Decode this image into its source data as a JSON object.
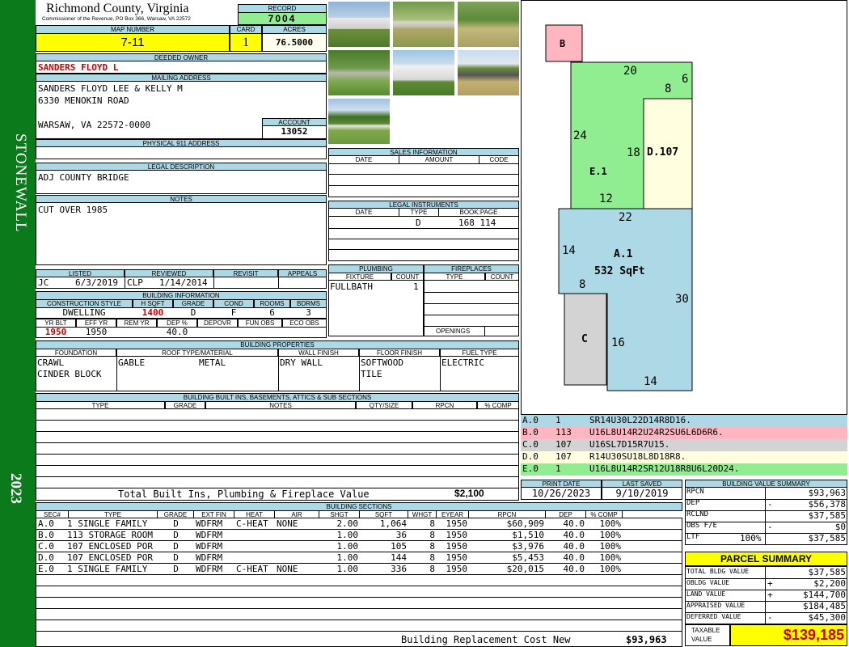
{
  "side": {
    "district": "STONEWALL",
    "year": "2023"
  },
  "header": {
    "county": "Richmond County, Virginia",
    "commissioner": "Commissioner of the Revenue, PO Box 366, Warsaw, VA 22572",
    "record_label": "RECORD",
    "record": "7004"
  },
  "ids": {
    "map_label": "MAP NUMBER",
    "map": "7-11",
    "card_label": "CARD",
    "card": "1",
    "acres_label": "ACRES",
    "acres": "76.5000"
  },
  "owner": {
    "label": "DEEDED OWNER",
    "name": "SANDERS FLOYD L",
    "mail_label": "MAILING ADDRESS",
    "mail": [
      "SANDERS FLOYD LEE & KELLY M",
      "6330 MENOKIN ROAD",
      "",
      "WARSAW, VA 22572-0000"
    ],
    "account_label": "ACCOUNT",
    "account": "13052",
    "phys_label": "PHYSICAL 911 ADDRESS",
    "phys": ""
  },
  "legal": {
    "label": "LEGAL DESCRIPTION",
    "text": "ADJ COUNTY BRIDGE"
  },
  "notes": {
    "label": "NOTES",
    "text": "CUT OVER 1985"
  },
  "sales": {
    "label": "SALES INFORMATION",
    "cols": [
      "DATE",
      "AMOUNT",
      "CODE"
    ]
  },
  "instruments": {
    "label": "LEGAL INSTRUMENTS",
    "cols": [
      "DATE",
      "TYPE",
      "BOOK:PAGE"
    ],
    "type": "D",
    "book": "168 114"
  },
  "listing": {
    "listed_label": "LISTED",
    "reviewed_label": "REVIEWED",
    "revisit_label": "REVISIT",
    "appeals_label": "APPEALS",
    "lister": "JC",
    "listed": "6/3/2019",
    "reviewer": "CLP",
    "reviewed": "1/14/2014"
  },
  "plumbing": {
    "label": "PLUMBING",
    "fixture_label": "FIXTURE",
    "count_label": "COUNT",
    "fixture": "FULLBATH",
    "count": "1"
  },
  "fireplaces": {
    "label": "FIREPLACES",
    "type_label": "TYPE",
    "count_label": "COUNT",
    "openings_label": "OPENINGS"
  },
  "building": {
    "label": "BUILDING INFORMATION",
    "cols": [
      "CONSTRUCTION STYLE",
      "H SQFT",
      "GRADE",
      "COND",
      "ROOMS",
      "BDRMS"
    ],
    "style": "DWELLING",
    "hsqft": "1400",
    "grade": "D",
    "cond": "F",
    "rooms": "6",
    "bdrms": "3",
    "cols2": [
      "YR BLT",
      "EFF YR",
      "REM YR",
      "DEP %",
      "DEPOVR",
      "FUN OBS",
      "ECO OBS"
    ],
    "yrblt": "1950",
    "effyr": "1950",
    "dep": "40.0"
  },
  "props": {
    "label": "BUILDING PROPERTIES",
    "cols": [
      "FOUNDATION",
      "ROOF TYPE/MATERIAL",
      "WALL FINISH",
      "FLOOR FINISH",
      "FUEL TYPE"
    ],
    "foundation": [
      "CRAWL",
      "CINDER BLOCK"
    ],
    "roof_type": "GABLE",
    "roof_mat": "METAL",
    "wall": "DRY WALL",
    "floor": [
      "SOFTWOOD",
      "TILE"
    ],
    "fuel": "ELECTRIC"
  },
  "builtins": {
    "label": "BUILDING BUILT INS, BASEMENTS, ATTICS & SUB SECTIONS",
    "cols": [
      "TYPE",
      "GRADE",
      "NOTES",
      "QTY/SIZE",
      "RPCN",
      "% COMP"
    ],
    "total_label": "Total Built Ins, Plumbing & Fireplace Value",
    "total": "$2,100"
  },
  "dates": {
    "print_label": "PRINT DATE",
    "print": "10/26/2023",
    "saved_label": "LAST SAVED",
    "saved": "9/10/2019"
  },
  "sketch_codes": [
    {
      "sec": "A.0",
      "code": "1",
      "path": "SR14U30L22D14R8D16.",
      "color": "#add8e6"
    },
    {
      "sec": "B.0",
      "code": "113",
      "path": "U16L8U14R2U24R2SU6L6D6R6.",
      "color": "#ffb6c1"
    },
    {
      "sec": "C.0",
      "code": "107",
      "path": "U16SL7D15R7U15.",
      "color": "#d3d3d3"
    },
    {
      "sec": "D.0",
      "code": "107",
      "path": "R14U30SU18L8D18R8.",
      "color": "#ffffe0"
    },
    {
      "sec": "E.0",
      "code": "1",
      "path": "U16L8U14R2SR12U18R8U6L20D24.",
      "color": "#90ee90"
    }
  ],
  "sketch": {
    "labels": {
      "b": "B",
      "e": "E.1",
      "d": "D.107",
      "a": "A.1",
      "a_area": "532 SqFt",
      "c": "C"
    },
    "dims": [
      "20",
      "8",
      "6",
      "24",
      "18",
      "12",
      "22",
      "14",
      "8",
      "30",
      "16",
      "14"
    ]
  },
  "sections": {
    "label": "BUILDING SECTIONS",
    "cols": [
      "SEC#",
      "TYPE",
      "GRADE",
      "EXT FIN",
      "HEAT",
      "AIR",
      "SHGT",
      "SQFT",
      "WHGT",
      "EYEAR",
      "RPCN",
      "DEP",
      "% COMP"
    ],
    "rows": [
      [
        "A.0",
        "1 SINGLE FAMILY",
        "D",
        "WDFRM",
        "C-HEAT",
        "NONE",
        "2.00",
        "1,064",
        "8",
        "1950",
        "$60,909",
        "40.0",
        "100%"
      ],
      [
        "B.0",
        "113 STORAGE ROOM",
        "D",
        "WDFRM",
        "",
        "",
        "1.00",
        "36",
        "8",
        "1950",
        "$1,510",
        "40.0",
        "100%"
      ],
      [
        "C.0",
        "107 ENCLOSED PORCH",
        "D",
        "WDFRM",
        "",
        "",
        "1.00",
        "105",
        "8",
        "1950",
        "$3,976",
        "40.0",
        "100%"
      ],
      [
        "D.0",
        "107 ENCLOSED PORCH",
        "D",
        "WDFRM",
        "",
        "",
        "1.00",
        "144",
        "8",
        "1950",
        "$5,453",
        "40.0",
        "100%"
      ],
      [
        "E.0",
        "1 SINGLE FAMILY",
        "D",
        "WDFRM",
        "C-HEAT",
        "NONE",
        "1.00",
        "336",
        "8",
        "1950",
        "$20,015",
        "40.0",
        "100%"
      ]
    ],
    "total_label": "Building Replacement Cost New",
    "total": "$93,963"
  },
  "value_summary": {
    "label": "BUILDING VALUE SUMMARY",
    "rpcn_label": "RPCN",
    "rpcn": "$93,963",
    "dep_label": "DEP",
    "dep_sign": "-",
    "dep": "$56,378",
    "rclnd_label": "RCLND",
    "rclnd": "$37,585",
    "obs_label": "OBS F/E",
    "obs_sign": "-",
    "obs": "$0",
    "ltf_label": "LTF",
    "ltf_pct": "100%",
    "ltf": "$37,585"
  },
  "parcel": {
    "label": "PARCEL SUMMARY",
    "total_bldg_label": "TOTAL BLDG VALUE",
    "total_bldg": "$37,585",
    "obldg_label": "OBLDG VALUE",
    "obldg_sign": "+",
    "obldg": "$2,200",
    "land_label": "LAND VALUE",
    "land_sign": "+",
    "land": "$144,700",
    "appraised_label": "APPRAISED VALUE",
    "appraised": "$184,485",
    "deferred_label": "DEFERRED VALUE",
    "deferred_sign": "-",
    "deferred": "$45,300",
    "taxable_label1": "TAXABLE",
    "taxable_label2": "VALUE",
    "taxable": "$139,185"
  }
}
